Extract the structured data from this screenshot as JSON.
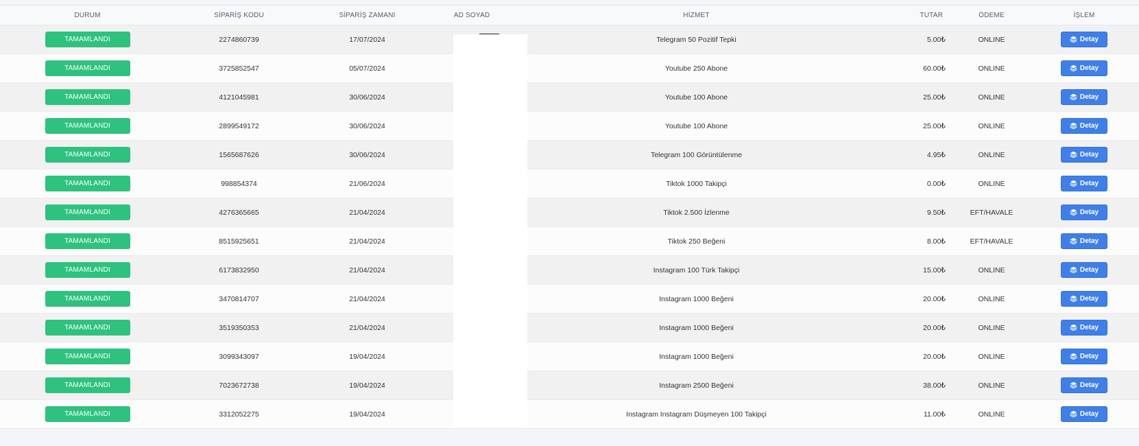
{
  "table": {
    "headers": [
      "DURUM",
      "SİPARİŞ KODU",
      "SİPARİŞ ZAMANI",
      "AD SOYAD",
      "HİZMET",
      "TUTAR",
      "ÖDEME",
      "İŞLEM"
    ],
    "detail_label": "Detay",
    "rows": [
      {
        "status": "TAMAMLANDI",
        "code": "2274860739",
        "date": "17/07/2024",
        "name": "",
        "service": "Telegram 50 Pozitif Tepki",
        "amount": "5.00₺",
        "payment": "ONLINE"
      },
      {
        "status": "TAMAMLANDI",
        "code": "3725852547",
        "date": "05/07/2024",
        "name": "",
        "service": "Youtube 250 Abone",
        "amount": "60.00₺",
        "payment": "ONLINE"
      },
      {
        "status": "TAMAMLANDI",
        "code": "4121045981",
        "date": "30/06/2024",
        "name": "",
        "service": "Youtube 100 Abone",
        "amount": "25.00₺",
        "payment": "ONLINE"
      },
      {
        "status": "TAMAMLANDI",
        "code": "2899549172",
        "date": "30/06/2024",
        "name": "",
        "service": "Youtube 100 Abone",
        "amount": "25.00₺",
        "payment": "ONLINE"
      },
      {
        "status": "TAMAMLANDI",
        "code": "1565687626",
        "date": "30/06/2024",
        "name": "",
        "service": "Telegram 100 Görüntülenme",
        "amount": "4.95₺",
        "payment": "ONLINE"
      },
      {
        "status": "TAMAMLANDI",
        "code": "998854374",
        "date": "21/06/2024",
        "name": "",
        "service": "Tiktok 1000 Takipçi",
        "amount": "0.00₺",
        "payment": "ONLINE"
      },
      {
        "status": "TAMAMLANDI",
        "code": "4276365665",
        "date": "21/04/2024",
        "name": "",
        "service": "Tiktok 2.500 İzlenme",
        "amount": "9.50₺",
        "payment": "EFT/HAVALE"
      },
      {
        "status": "TAMAMLANDI",
        "code": "8515925651",
        "date": "21/04/2024",
        "name": "",
        "service": "Tiktok 250 Beğeni",
        "amount": "8.00₺",
        "payment": "EFT/HAVALE"
      },
      {
        "status": "TAMAMLANDI",
        "code": "6173832950",
        "date": "21/04/2024",
        "name": "",
        "service": "Instagram 100 Türk Takipçi",
        "amount": "15.00₺",
        "payment": "ONLINE"
      },
      {
        "status": "TAMAMLANDI",
        "code": "3470814707",
        "date": "21/04/2024",
        "name": "",
        "service": "Instagram 1000 Beğeni",
        "amount": "20.00₺",
        "payment": "ONLINE"
      },
      {
        "status": "TAMAMLANDI",
        "code": "3519350353",
        "date": "21/04/2024",
        "name": "",
        "service": "Instagram 1000 Beğeni",
        "amount": "20.00₺",
        "payment": "ONLINE"
      },
      {
        "status": "TAMAMLANDI",
        "code": "3099343097",
        "date": "19/04/2024",
        "name": "",
        "service": "Instagram 1000 Beğeni",
        "amount": "20.00₺",
        "payment": "ONLINE"
      },
      {
        "status": "TAMAMLANDI",
        "code": "7023672738",
        "date": "19/04/2024",
        "name": "",
        "service": "Instagram 2500 Beğeni",
        "amount": "38.00₺",
        "payment": "ONLINE"
      },
      {
        "status": "TAMAMLANDI",
        "code": "3312052275",
        "date": "19/04/2024",
        "name": "",
        "service": "Instagram Instagram Düşmeyen 100 Takipçi",
        "amount": "11.00₺",
        "payment": "ONLINE"
      }
    ]
  },
  "colors": {
    "status_green": "#2ec27e",
    "detail_blue": "#3f7fe8"
  },
  "icons": {
    "detail": "layers-icon"
  }
}
